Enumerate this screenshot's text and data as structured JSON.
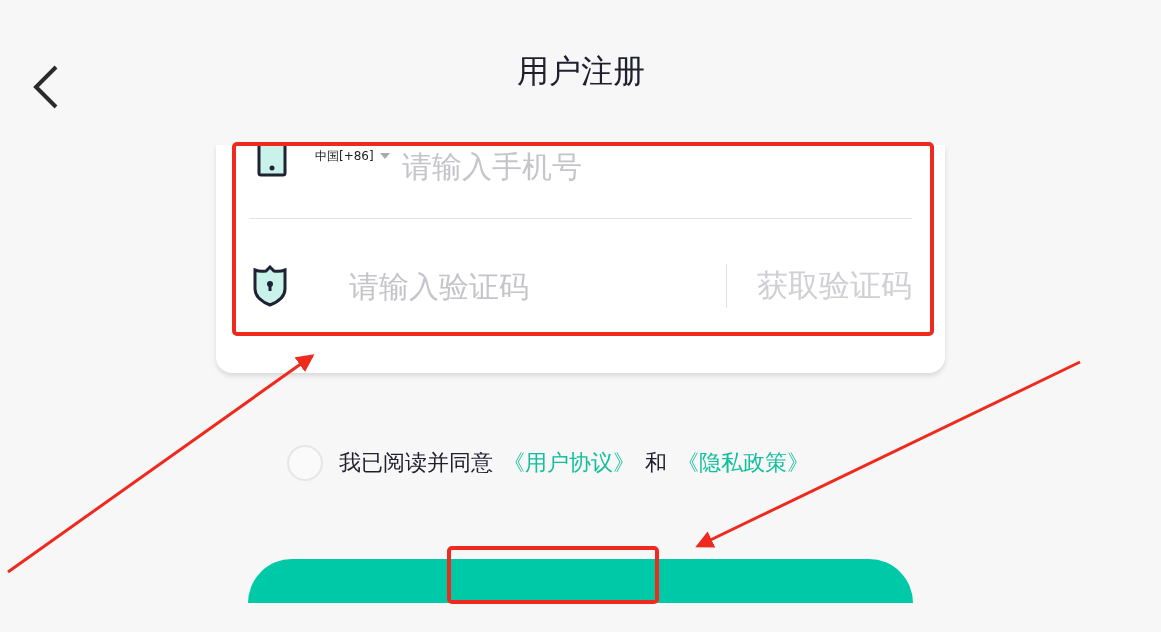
{
  "header": {
    "title": "用户注册"
  },
  "phone_field": {
    "country": "中国[+86]",
    "placeholder": "请输入手机号"
  },
  "code_field": {
    "placeholder": "请输入验证码",
    "action": "获取验证码"
  },
  "agreement": {
    "checked": false,
    "text": "我已阅读并同意",
    "links": [
      "《用户协议》",
      "《隐私政策》"
    ],
    "joiner": "和"
  }
}
